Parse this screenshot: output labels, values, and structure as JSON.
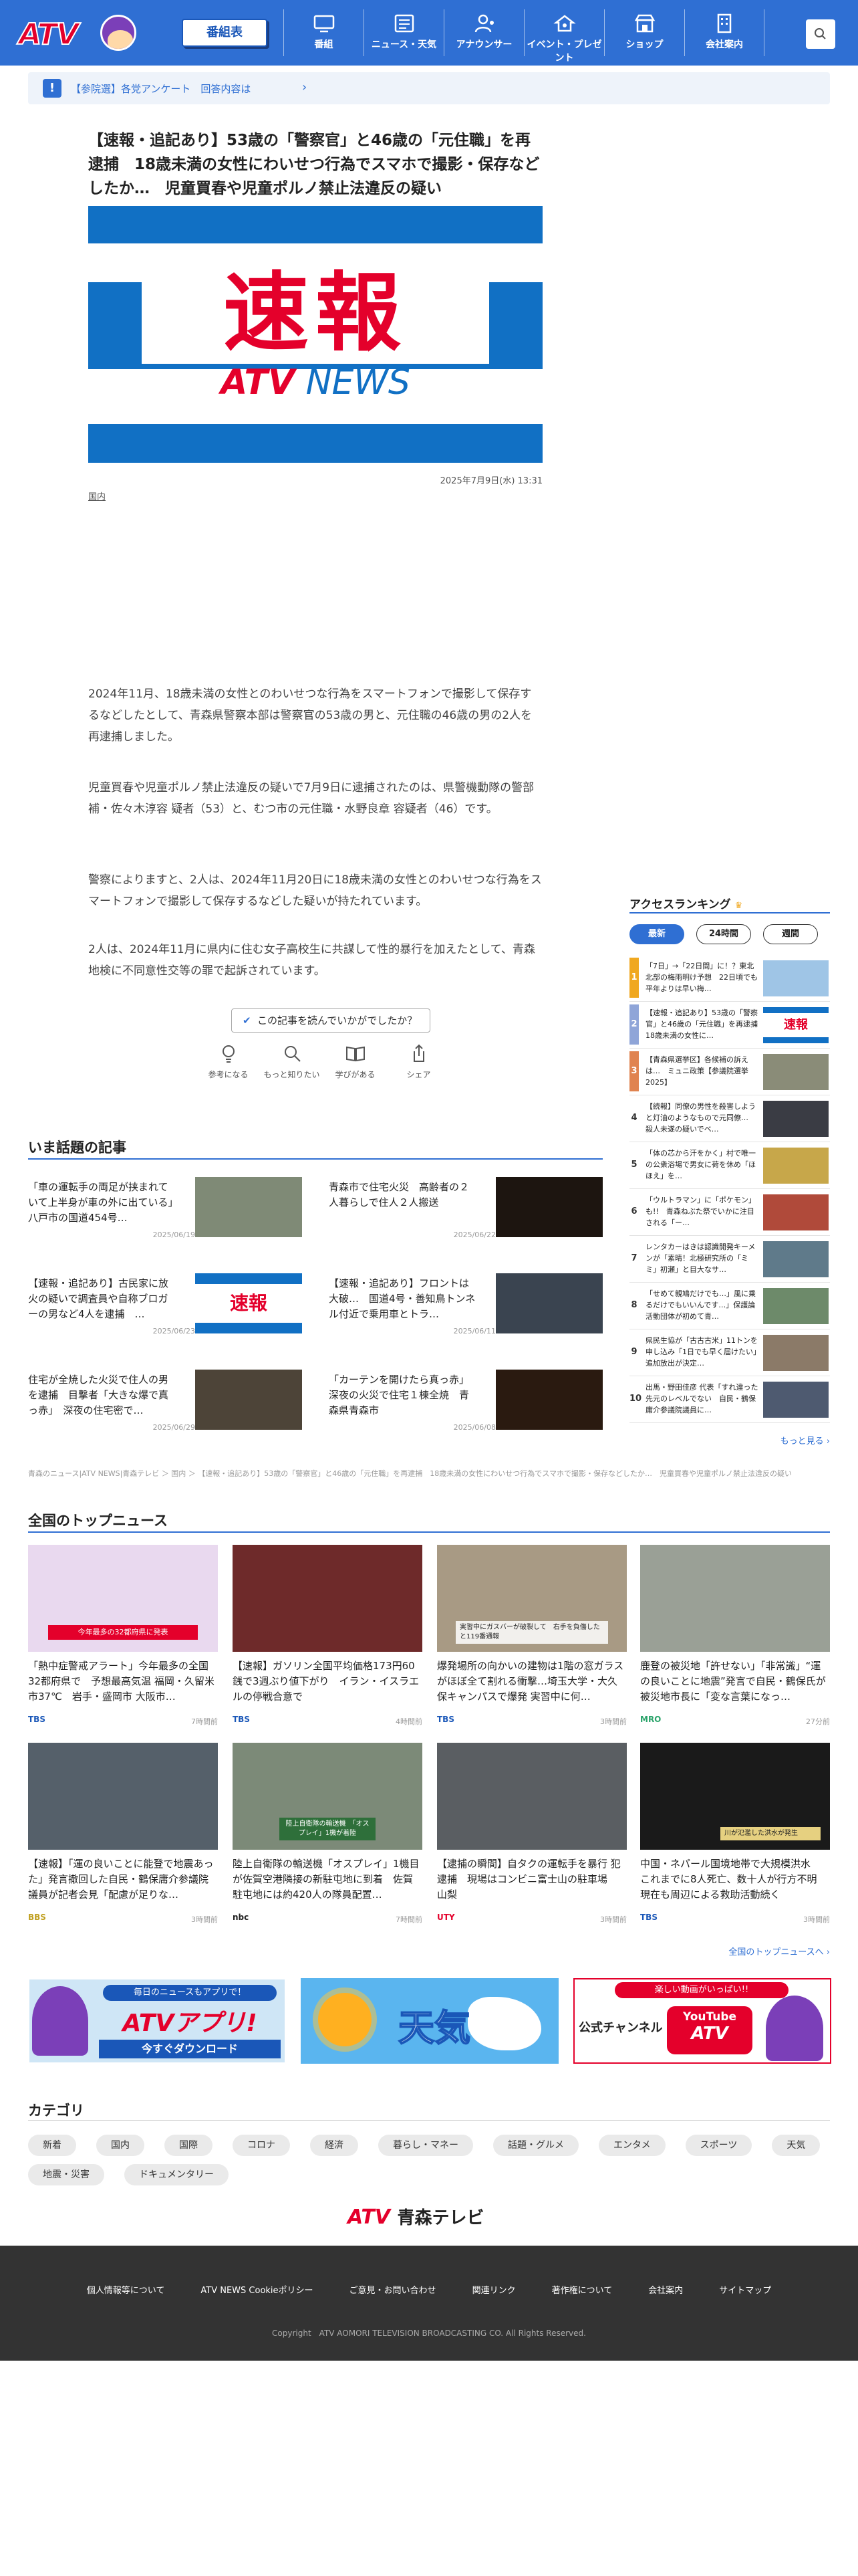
{
  "header": {
    "logo_text": "ATV",
    "program_button": "番組表",
    "nav": [
      "番組",
      "ニュース・天気",
      "アナウンサー",
      "イベント・プレゼント",
      "ショップ",
      "会社案内"
    ]
  },
  "survey": {
    "text": "【参院選】各党アンケート　回答内容は",
    "arrow": "›",
    "badge": "!"
  },
  "article": {
    "title": "【速報・追記あり】53歳の「警察官」と46歳の「元住職」を再逮捕　18歳未満の女性にわいせつ行為でスマホで撮影・保存などしたか…　児童買春や児童ポルノ禁止法違反の疑い",
    "hero_big": "速報",
    "hero_brand_a": "ATV",
    "hero_brand_b": "NEWS",
    "date": "2025年7月9日(水) 13:31",
    "category": "国内",
    "paragraphs": [
      "2024年11月、18歳未満の女性とのわいせつな行為をスマートフォンで撮影して保存するなどしたとして、青森県警察本部は警察官の53歳の男と、元住職の46歳の男の2人を再逮捕しました。",
      "児童買春や児童ポルノ禁止法違反の疑いで7月9日に逮捕されたのは、県警機動隊の警部補・佐々木淳容 疑者（53）と、むつ市の元住職・水野良章 容疑者（46）です。",
      "警察によりますと、2人は、2024年11月20日に18歳未満の女性とのわいせつな行為をスマートフォンで撮影して保存するなどした疑いが持たれています。",
      "2人は、2024年11月に県内に住む女子高校生に共謀して性的暴行を加えたとして、青森地検に不同意性交等の罪で起訴されています。"
    ],
    "feedback_question": "この記事を読んでいかがでしたか？",
    "reactions": [
      "参考になる",
      "もっと知りたい",
      "学びがある",
      "シェア"
    ]
  },
  "hot_topics": {
    "heading": "いま話題の記事",
    "items": [
      {
        "title": "「車の運転手の両足が挟まれていて上半身が車の外に出ている」八戸市の国道454号…",
        "date": "2025/06/19"
      },
      {
        "title": "青森市で住宅火災　高齢者の２人暮らしで住人２人搬送",
        "date": "2025/06/22"
      },
      {
        "title": "【速報・追記あり】古民家に放火の疑いで調査員や自称ブロガーの男など4人を逮捕　…",
        "date": "2025/06/23"
      },
      {
        "title": "【速報・追記あり】フロントは大破…　国道4号・善知鳥トンネル付近で乗用車とトラ…",
        "date": "2025/06/11"
      },
      {
        "title": "住宅が全焼した火災で住人の男を逮捕　目撃者「大きな爆で真っ赤」　深夜の住宅密で…",
        "date": "2025/06/29"
      },
      {
        "title": "「カーテンを開けたら真っ赤」深夜の火災で住宅１棟全焼　青森県青森市",
        "date": "2025/06/08"
      }
    ]
  },
  "ranking": {
    "heading": "アクセスランキング",
    "tabs": [
      "最新",
      "24時間",
      "週間"
    ],
    "items": [
      {
        "num": "1",
        "title": "「7日」→「22日間」に！？東北北部の梅雨明け予想　22日頃でも平年よりは早い梅…"
      },
      {
        "num": "2",
        "title": "【速報・追記あり】53歳の「警察官」と46歳の「元住職」を再逮捕　18歳未満の女性に…"
      },
      {
        "num": "3",
        "title": "【青森県選挙区】各候補の訴えは…　ミュニ政策【参議院選挙2025】"
      },
      {
        "num": "4",
        "title": "【続報】同僚の男性を殺害しようと灯油のようなもので元同僚…　殺人未遂の疑いでベ…"
      },
      {
        "num": "5",
        "title": "「体の芯から汗をかく」村で唯一の公衆浴場で男女に荷を休め「ほほえ」を…"
      },
      {
        "num": "6",
        "title": "「ウルトラマン」に「ポケモン」も!!　青森ねぶた祭でいかに注目される「ー…"
      },
      {
        "num": "7",
        "title": "レンタカーはきは認識開発キーメンが「素晴！北極研究所の「ミミ」初瀬」と目大なサ…"
      },
      {
        "num": "8",
        "title": "「せめて親鳩だけでも…」風に乗るだけでもいいんです…」保護論活動団体が初めて青…"
      },
      {
        "num": "9",
        "title": "県民生協が「古古古米」11トンを申し込み「1日でも早く届けたい」　追加放出が決定…"
      },
      {
        "num": "10",
        "title": "出馬・野田佳彦 代表「すれ違った先元のレベルでない　自民・鶴保庸介参議院議員に…"
      }
    ],
    "more": "もっと見る ›"
  },
  "breadcrumb": "青森のニュース|ATV NEWS|青森テレビ ＞ 国内 ＞ 【速報・追記あり】53歳の「警察官」と46歳の「元住職」を再逮捕　18歳未満の女性にわいせつ行為でスマホで撮影・保存などしたか…　児童買春や児童ポルノ禁止法違反の疑い",
  "top_news": {
    "heading": "全国のトップニュース",
    "items": [
      {
        "title": "「熱中症警戒アラート」今年最多の全国32都府県で　予想最高気温 福岡・久留米市37℃　岩手・盛岡市 大阪市…",
        "src": "TBS",
        "time": "7時間前",
        "caption": "今年最多の32都府県に発表"
      },
      {
        "title": "【速報】ガソリン全国平均価格173円60銭で3週ぶり値下がり　イラン・イスラエルの停戦合意で",
        "src": "TBS",
        "time": "4時間前",
        "caption": ""
      },
      {
        "title": "爆発場所の向かいの建物は1階の窓ガラスがほぼ全て割れる衝撃…埼玉大学・大久保キャンパスで爆発 実習中に何…",
        "src": "TBS",
        "time": "3時間前",
        "caption": "実習中にガスバーが破裂して　右手を負傷した　と119番通報"
      },
      {
        "title": "鹿登の被災地「許せない」「非常識」“運の良いことに地震”発言で自民・鶴保氏が被災地市長に「変な言葉になっ…",
        "src": "MRO",
        "time": "27分前",
        "caption": ""
      },
      {
        "title": "【速報】「運の良いことに能登で地震あった」発言撤回した自民・鶴保庸介参議院議員が記者会見「配慮が足りな…",
        "src": "BBS",
        "time": "3時間前",
        "caption": ""
      },
      {
        "title": "陸上自衛隊の輸送機「オスプレイ」1機目が佐賀空港隣接の新駐屯地に到着　佐賀駐屯地には約420人の隊員配置…",
        "src": "nbc",
        "time": "7時間前",
        "caption": "陸上自衛隊の輸送機　「オスプレイ」1機が着陸"
      },
      {
        "title": "【逮捕の瞬間】自タクの運転手を暴行 犯逮捕　現場はコンビニ富士山の駐車場　山梨",
        "src": "UTY",
        "time": "3時間前",
        "caption": ""
      },
      {
        "title": "中国・ネパール国境地帯で大規模洪水　これまでに8人死亡、数十人が行方不明　現在も周辺による救助活動続く",
        "src": "TBS",
        "time": "3時間前",
        "caption": "川が氾濫した洪水が発生"
      }
    ],
    "more": "全国のトップニュースへ ›"
  },
  "banners": [
    {
      "top": "毎日のニュースもアプリで！",
      "main": "ATVアプリ!",
      "bottom": "今すぐダウンロード"
    },
    {
      "main": "天気"
    },
    {
      "top": "楽しい動画がいっぱい!!",
      "left": "公式チャンネル",
      "badge": "YouTube",
      "badge2": "ATV"
    }
  ],
  "categories": {
    "heading": "カテゴリ",
    "items": [
      "新着",
      "国内",
      "国際",
      "コロナ",
      "経済",
      "暮らし・マネー",
      "話題・グルメ",
      "エンタメ",
      "スポーツ",
      "天気",
      "地震・災害",
      "ドキュメンタリー"
    ]
  },
  "footer": {
    "logo_a": "ATV",
    "logo_b": "青森テレビ",
    "links": [
      "個人情報等について",
      "ATV NEWS Cookieポリシー",
      "ご意見・お問い合わせ",
      "関連リンク",
      "著作権について",
      "会社案内",
      "サイトマップ"
    ],
    "copyright": "Copyright　ATV AOMORI TELEVISION BROADCASTING CO. All Rights Reserved."
  },
  "colors": {
    "brand": "#2f6fd3",
    "red": "#e4002b",
    "rank1": "#f0a820",
    "rank2": "#8fa5d8",
    "rank3": "#e08350"
  }
}
